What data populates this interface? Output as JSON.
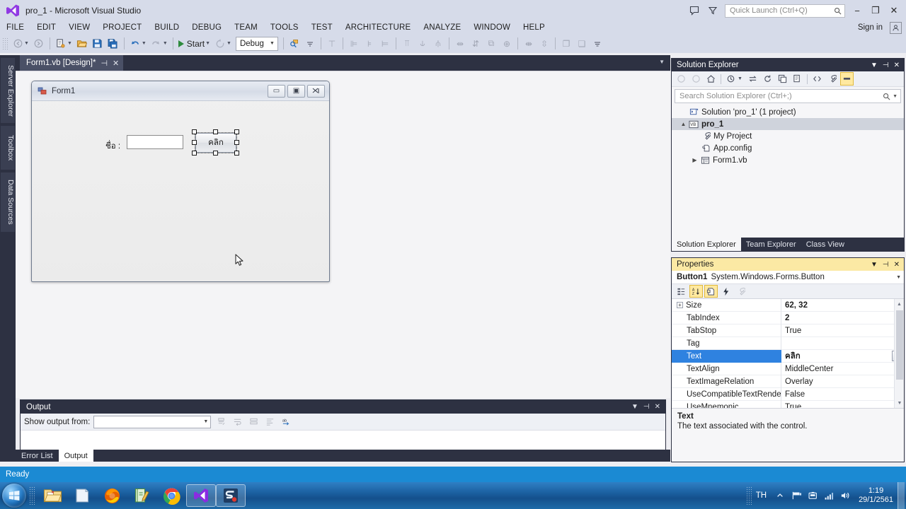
{
  "window": {
    "title": "pro_1 - Microsoft Visual Studio",
    "logo_name": "visual-studio-logo",
    "minimize": "−",
    "restore": "❐",
    "close": "✕"
  },
  "titlebar_right": {
    "feedback_icon": "feedback-icon",
    "filter_icon": "filter-icon",
    "quick_launch_placeholder": "Quick Launch (Ctrl+Q)",
    "search_icon": "search-icon"
  },
  "menu": {
    "items": [
      "FILE",
      "EDIT",
      "VIEW",
      "PROJECT",
      "BUILD",
      "DEBUG",
      "TEAM",
      "TOOLS",
      "TEST",
      "ARCHITECTURE",
      "ANALYZE",
      "WINDOW",
      "HELP"
    ],
    "sign_in": "Sign in",
    "account_icon": "account-icon"
  },
  "toolbar": {
    "nav_back": "back-icon",
    "nav_forward": "forward-icon",
    "new_project": "new-project-icon",
    "open_file": "open-file-icon",
    "save": "save-icon",
    "save_all": "save-all-icon",
    "undo": "undo-icon",
    "redo": "redo-icon",
    "start_label": "Start",
    "start_icon": "play-icon",
    "restart_icon": "restart-icon",
    "config": "Debug",
    "find_icon": "find-icon",
    "overflow_icon": "overflow-icon"
  },
  "left_rail": {
    "tabs": [
      "Server Explorer",
      "Toolbox",
      "Data Sources"
    ]
  },
  "editor": {
    "tab_label": "Form1.vb [Design]*",
    "pin_icon": "pin-icon",
    "close_icon": "close-icon",
    "dropdown_icon": "chevron-down-icon"
  },
  "designer": {
    "form": {
      "title": "Form1",
      "icon": "form-icon",
      "minimize": "▭",
      "maximize": "▣",
      "close": "✕",
      "label_text": "ชื่อ :",
      "textbox_value": "",
      "button_text": "คลิก"
    },
    "cursor": "mouse-pointer"
  },
  "output": {
    "title": "Output",
    "dropdown_icon": "chevron-down-icon",
    "pin_icon": "pin-icon",
    "close_icon": "close-icon",
    "show_output_label": "Show output from:",
    "combo_value": "",
    "content": "",
    "toolbar_icons": [
      "clear-all-icon",
      "toggle-word-wrap-icon",
      "toggle-stack-icon",
      "find-message-icon",
      "go-to-icon"
    ]
  },
  "bottom_tabs": {
    "items": [
      {
        "label": "Error List",
        "active": false
      },
      {
        "label": "Output",
        "active": true
      }
    ]
  },
  "solution_explorer": {
    "title": "Solution Explorer",
    "dropdown_icon": "chevron-down-icon",
    "pin_icon": "pin-icon",
    "close_icon": "close-icon",
    "toolbar_icons": [
      "back-icon",
      "forward-icon",
      "home-icon",
      "pending-changes-icon",
      "sync-icon",
      "refresh-icon",
      "collapse-all-icon",
      "show-all-files-icon",
      "view-code-icon",
      "properties-icon",
      "preview-selected-icon"
    ],
    "search_placeholder": "Search Solution Explorer (Ctrl+;)",
    "search_icon": "search-icon",
    "search_dropdown_icon": "chevron-down-icon",
    "tree": [
      {
        "label": "Solution 'pro_1' (1 project)",
        "icon": "solution-icon",
        "indent": 0,
        "twisty": "",
        "selected": false,
        "bold": false
      },
      {
        "label": "pro_1",
        "icon": "vb-project-icon",
        "indent": 1,
        "twisty": "▲",
        "selected": true,
        "bold": true
      },
      {
        "label": "My Project",
        "icon": "my-project-icon",
        "indent": 2,
        "twisty": "",
        "selected": false,
        "bold": false
      },
      {
        "label": "App.config",
        "icon": "config-file-icon",
        "indent": 2,
        "twisty": "",
        "selected": false,
        "bold": false
      },
      {
        "label": "Form1.vb",
        "icon": "form-file-icon",
        "indent": 2,
        "twisty": "▶",
        "selected": false,
        "bold": false
      }
    ],
    "tabs": [
      {
        "label": "Solution Explorer",
        "active": true
      },
      {
        "label": "Team Explorer",
        "active": false
      },
      {
        "label": "Class View",
        "active": false
      }
    ]
  },
  "properties": {
    "title": "Properties",
    "dropdown_icon": "chevron-down-icon",
    "pin_icon": "pin-icon",
    "close_icon": "close-icon",
    "object_name": "Button1",
    "object_type": "System.Windows.Forms.Button",
    "object_dropdown_icon": "chevron-down-icon",
    "toolbar_icons": [
      "categorized-icon",
      "alphabetical-icon",
      "properties-page-icon",
      "events-icon",
      "property-pages-icon"
    ],
    "rows": [
      {
        "name": "Size",
        "value": "62, 32",
        "expandable": true,
        "selected": false,
        "bold_value": true,
        "combo": false
      },
      {
        "name": "TabIndex",
        "value": "2",
        "expandable": false,
        "selected": false,
        "bold_value": true,
        "combo": false
      },
      {
        "name": "TabStop",
        "value": "True",
        "expandable": false,
        "selected": false,
        "bold_value": false,
        "combo": false
      },
      {
        "name": "Tag",
        "value": "",
        "expandable": false,
        "selected": false,
        "bold_value": false,
        "combo": false
      },
      {
        "name": "Text",
        "value": "คลิก",
        "expandable": false,
        "selected": true,
        "bold_value": true,
        "combo": true
      },
      {
        "name": "TextAlign",
        "value": "MiddleCenter",
        "expandable": false,
        "selected": false,
        "bold_value": false,
        "combo": false
      },
      {
        "name": "TextImageRelation",
        "value": "Overlay",
        "expandable": false,
        "selected": false,
        "bold_value": false,
        "combo": false
      },
      {
        "name": "UseCompatibleTextRenderir",
        "value": "False",
        "expandable": false,
        "selected": false,
        "bold_value": false,
        "combo": false
      },
      {
        "name": "UseMnemonic",
        "value": "True",
        "expandable": false,
        "selected": false,
        "bold_value": false,
        "combo": false
      }
    ],
    "description_title": "Text",
    "description_body": "The text associated with the control."
  },
  "status_bar": {
    "text": "Ready"
  },
  "taskbar": {
    "start_icon": "windows-start-orb",
    "buttons": [
      {
        "name": "file-explorer-icon",
        "pinned": false
      },
      {
        "name": "notepad-icon",
        "pinned": false
      },
      {
        "name": "firefox-icon",
        "pinned": false
      },
      {
        "name": "editor-app-icon",
        "pinned": false
      },
      {
        "name": "chrome-icon",
        "pinned": false
      },
      {
        "name": "visual-studio-icon",
        "pinned": true
      },
      {
        "name": "snipping-app-icon",
        "pinned": true
      }
    ],
    "tray": {
      "language": "TH",
      "show_hidden_icon": "chevron-up-icon",
      "flag_icon": "action-center-icon",
      "device_icon": "removable-device-icon",
      "network_icon": "network-signal-icon",
      "volume_icon": "volume-icon",
      "time": "1:19",
      "date": "29/1/2561"
    }
  },
  "colors": {
    "title_bar": "#d6dbe9",
    "panel_header": "#2d3142",
    "accent_selected": "#2f82e0",
    "properties_header": "#fbe9a4",
    "status_bar": "#1b8ad3"
  }
}
